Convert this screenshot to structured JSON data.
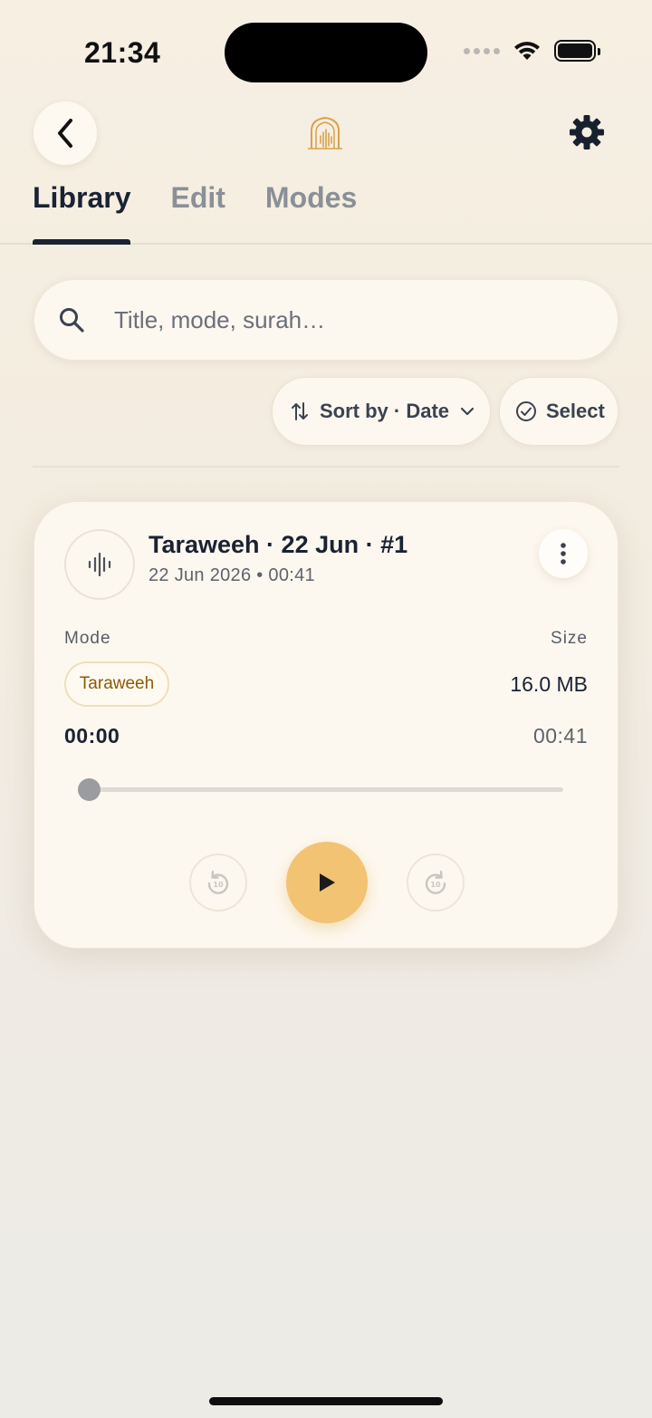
{
  "status_bar": {
    "time": "21:34"
  },
  "header": {
    "back_icon": "chevron-left-icon",
    "logo_icon": "mosque-arch-logo",
    "settings_icon": "gear-icon",
    "accent_color": "#d9a24a"
  },
  "tabs": [
    {
      "label": "Library",
      "active": true
    },
    {
      "label": "Edit",
      "active": false
    },
    {
      "label": "Modes",
      "active": false
    }
  ],
  "search": {
    "placeholder": "Title, mode, surah…",
    "value": ""
  },
  "toolbar": {
    "sort_label": "Sort by · Date",
    "select_label": "Select"
  },
  "recordings": [
    {
      "title": "Taraweeh · 22 Jun · #1",
      "subtitle": "22 Jun 2026 • 00:41",
      "mode_label": "Mode",
      "mode_value": "Taraweeh",
      "size_label": "Size",
      "size_value": "16.0 MB",
      "current_time": "00:00",
      "total_time": "00:41",
      "progress": 0.0,
      "skip_seconds": "10"
    }
  ],
  "colors": {
    "play_button": "#f2c372",
    "chip_text": "#8a5a06",
    "chip_border": "#efdfb9",
    "text_primary": "#1a2233"
  }
}
